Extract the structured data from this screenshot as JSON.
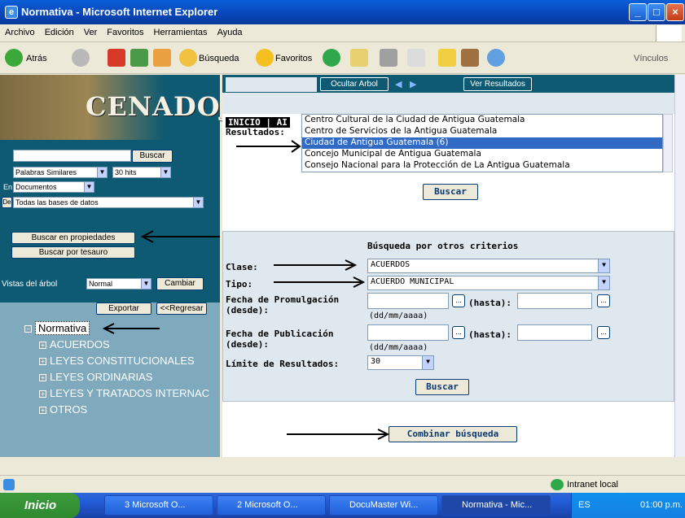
{
  "window": {
    "title": "Normativa - Microsoft Internet Explorer"
  },
  "menu": [
    "Archivo",
    "Edición",
    "Ver",
    "Favoritos",
    "Herramientas",
    "Ayuda"
  ],
  "toolbar": {
    "back": "Atrás",
    "search": "Búsqueda",
    "favorites": "Favoritos",
    "links": "Vínculos"
  },
  "left": {
    "brand": "CENADOJ",
    "search_button": "Buscar",
    "similar_select": "Palabras Similares",
    "hits_select": "30 hits",
    "en_label": "En",
    "en_select": "Documentos",
    "de_label": "De",
    "de_select": "Todas las bases de datos",
    "props_button": "Buscar en propiedades",
    "thesaurus_button": "Buscar por tesauro",
    "tree_view_label": "Vistas del árbol",
    "tree_view_select": "Normal",
    "change_button": "Cambiar",
    "export_button": "Exportar",
    "return_button": "<<Regresar",
    "tree": {
      "root": "Normativa",
      "items": [
        "ACUERDOS",
        "LEYES CONSTITUCIONALES",
        "LEYES ORDINARIAS",
        "LEYES Y TRATADOS INTERNAC",
        "OTROS"
      ]
    }
  },
  "right": {
    "nav_toolbar": {
      "hide_tree": "Ocultar Arbol",
      "show_results": "Ver Resultados"
    },
    "header": {
      "inicio": "INICIO",
      "sep": "|",
      "ai": "AI",
      "results_label": "Resultados:"
    },
    "results_list": [
      "Centro Cultural de la Ciudad de Antigua Guatemala",
      "Centro de Servicios de la Antigua Guatemala",
      "Ciudad de Antigua Guatemala (6)",
      "Concejo Municipal de Antigua Guatemala",
      "Consejo Nacional para la Protección de La Antigua Guatemala"
    ],
    "selected_result": "Ciudad de Antigua Guatemala (6)",
    "search_button": "Buscar",
    "criteria_title": "Búsqueda por otros criterios",
    "clase_label": "Clase:",
    "clase_value": "ACUERDOS",
    "tipo_label": "Tipo:",
    "tipo_value": "ACUERDO MUNICIPAL",
    "promulgacion_label_1": "Fecha de Promulgación",
    "promulgacion_label_2": "(desde):",
    "hasta": "(hasta):",
    "date_format": "(dd/mm/aaaa)",
    "publicacion_label_1": "Fecha de Publicación",
    "publicacion_label_2": "(desde):",
    "limit_label": "Límite de Resultados:",
    "limit_value": "30",
    "criteria_search_button": "Buscar",
    "combine_button": "Combinar búsqueda",
    "cal_glyph": "..."
  },
  "status": {
    "zone": "Intranet local"
  },
  "taskbar": {
    "start": "Inicio",
    "tasks": [
      "3 Microsoft O...",
      "2 Microsoft O...",
      "DocuMaster Wi...",
      "Normativa - Mic..."
    ],
    "lang": "ES",
    "time": "01:00 p.m."
  }
}
